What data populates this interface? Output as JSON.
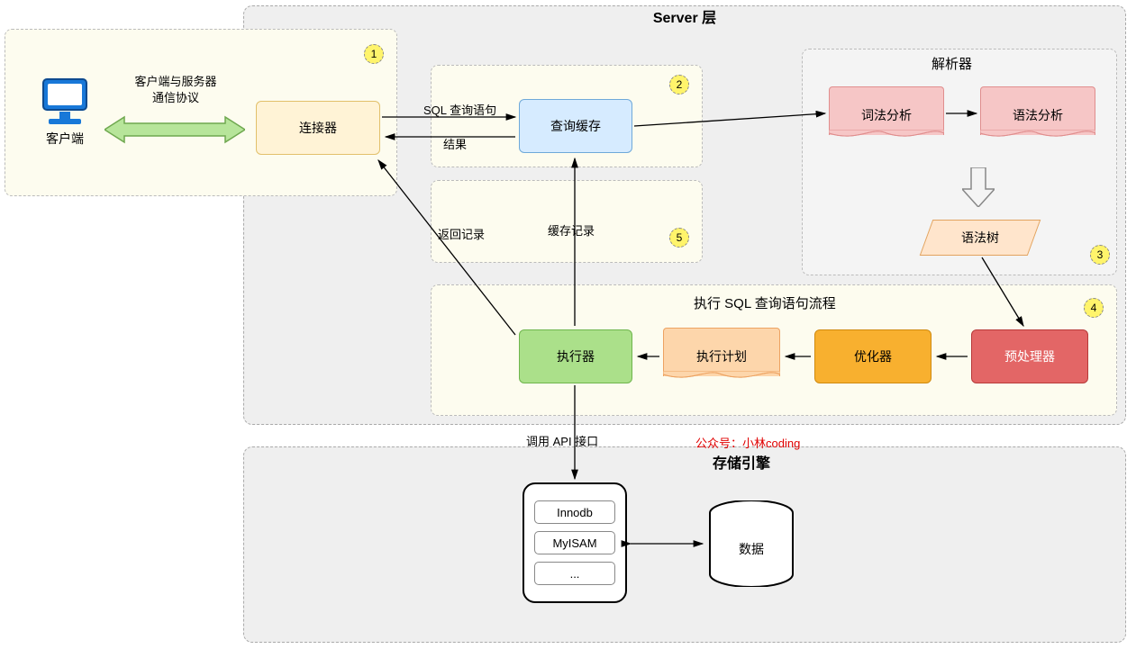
{
  "layers": {
    "server_title": "Server 层",
    "storage_title": "存储引擎"
  },
  "client": {
    "label": "客户端",
    "comm_label": "客户端与服务器\n通信协议"
  },
  "badges": {
    "b1": "1",
    "b2": "2",
    "b3": "3",
    "b4": "4",
    "b5": "5"
  },
  "nodes": {
    "connector": "连接器",
    "query_cache": "查询缓存",
    "lex": "词法分析",
    "syntax": "语法分析",
    "parser_title": "解析器",
    "syntax_tree": "语法树",
    "exec_flow_title": "执行 SQL 查询语句流程",
    "preprocessor": "预处理器",
    "optimizer": "优化器",
    "exec_plan": "执行计划",
    "executor": "执行器"
  },
  "edges": {
    "sql_stmt": "SQL 查询语句",
    "result": "结果",
    "cache_record": "缓存记录",
    "return_record": "返回记录",
    "api_call": "调用 API 接口"
  },
  "storage": {
    "engines": [
      "Innodb",
      "MyISAM",
      "..."
    ],
    "db": "数据"
  },
  "watermark": "公众号：小林coding"
}
